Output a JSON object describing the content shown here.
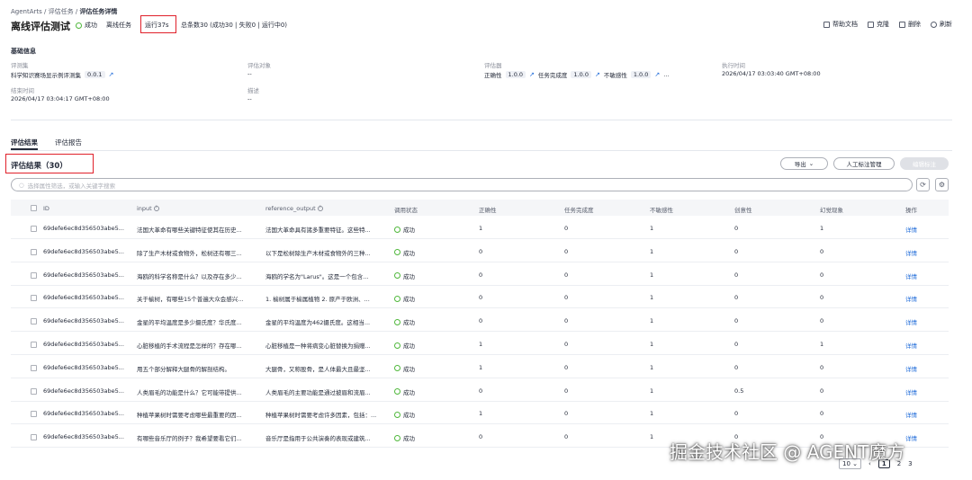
{
  "header": {
    "breadcrumb": [
      "AgentArts",
      "评估任务",
      "评估任务详情"
    ],
    "breadcrumb_sep": "/",
    "title": "离线评估测试",
    "status": "成功",
    "task_type": "离线任务",
    "run_time": "运行37s",
    "summary": "总条数30 (成功30 | 失败0 | 运行中0)",
    "actions": [
      "帮助文档",
      "克隆",
      "删除",
      "刷新"
    ]
  },
  "basic_info": {
    "section_title": "基础信息",
    "eval_set_label": "评测集",
    "eval_set_name": "科学知识赛场显示例评测集",
    "eval_set_version": "0.0.1",
    "eval_target_label": "评估对象",
    "eval_target_value": "--",
    "evaluators_label": "评估器",
    "evaluators": [
      {
        "name": "正确性",
        "version": "1.0.0"
      },
      {
        "name": "任务完成度",
        "version": "1.0.0"
      },
      {
        "name": "不敏感性",
        "version": "1.0.0"
      }
    ],
    "evaluators_more": "...",
    "exec_time_label": "执行时间",
    "exec_time_value": "2026/04/17 03:03:40 GMT+08:00",
    "end_time_label": "结束时间",
    "end_time_value": "2026/04/17 03:04:17 GMT+08:00",
    "desc_label": "描述",
    "desc_value": "--"
  },
  "tabs": [
    "评估结果",
    "评估报告"
  ],
  "results": {
    "title": "评估结果（30）",
    "export_label": "导出",
    "manual_label": "人工标注管理",
    "edit_label": "编辑标注",
    "search_placeholder": "选择属性筛选，或输入关键字搜索",
    "refresh_icon": "refresh-icon",
    "settings_icon": "gear-icon",
    "columns": [
      "ID",
      "input",
      "reference_output",
      "调用状态",
      "正确性",
      "任务完成度",
      "不敏感性",
      "创意性",
      "幻觉现象",
      "操作"
    ],
    "rows": [
      {
        "id": "69defe6ec8d356503abe5...",
        "input": "法国大革命有哪些关键特征使其在历史...",
        "ref": "法国大革命具有諸多重要特征。这些特...",
        "status": "成功",
        "c1": "1",
        "c2": "0",
        "c3": "1",
        "c4": "0",
        "c5": "1",
        "op": "详情"
      },
      {
        "id": "69defe6ec8d356503abe5...",
        "input": "除了生产木材或食物外，松树还有哪三...",
        "ref": "以下是松树除生产木材或食物外的三种...",
        "status": "成功",
        "c1": "0",
        "c2": "0",
        "c3": "1",
        "c4": "0",
        "c5": "0",
        "op": "详情"
      },
      {
        "id": "69defe6ec8d356503abe5...",
        "input": "海鸥的科学名称是什么？以及存在多少...",
        "ref": "海鸥的学名为\"Larus\"。这是一个包含...",
        "status": "成功",
        "c1": "0",
        "c2": "0",
        "c3": "1",
        "c4": "0",
        "c5": "0",
        "op": "详情"
      },
      {
        "id": "69defe6ec8d356503abe5...",
        "input": "关于榆树，有哪些15个普遍大众会感兴...",
        "ref": "1. 榆树属于榆属植物 2. 原产于欧洲、...",
        "status": "成功",
        "c1": "0",
        "c2": "0",
        "c3": "1",
        "c4": "0",
        "c5": "0",
        "op": "详情"
      },
      {
        "id": "69defe6ec8d356503abe5...",
        "input": "金星的平均温度是多少摄氏度？华氏度...",
        "ref": "金星的平均温度为462摄氏度。这相当...",
        "status": "成功",
        "c1": "0",
        "c2": "0",
        "c3": "1",
        "c4": "0",
        "c5": "0",
        "op": "详情"
      },
      {
        "id": "69defe6ec8d356503abe5...",
        "input": "心脏移植的手术流程是怎样的？存在哪...",
        "ref": "心脏移植是一种将病变心脏替换为捐赠...",
        "status": "成功",
        "c1": "1",
        "c2": "0",
        "c3": "1",
        "c4": "0",
        "c5": "1",
        "op": "详情"
      },
      {
        "id": "69defe6ec8d356503abe5...",
        "input": "用五个部分解释大腿骨的解剖结构。",
        "ref": "大腿骨，又称股骨，是人体最大且最坚...",
        "status": "成功",
        "c1": "1",
        "c2": "0",
        "c3": "1",
        "c4": "0",
        "c5": "0",
        "op": "详情"
      },
      {
        "id": "69defe6ec8d356503abe5...",
        "input": "人类眉毛的功能是什么？它可能带提供...",
        "ref": "人类眉毛的主要功能是通过披眉和流眉...",
        "status": "成功",
        "c1": "0",
        "c2": "0",
        "c3": "1",
        "c4": "0.5",
        "c5": "0",
        "op": "详情"
      },
      {
        "id": "69defe6ec8d356503abe5...",
        "input": "种植苹果树时需要考虑哪些最重要的因...",
        "ref": "种植苹果树时需要考虑许多因素，包括：...",
        "status": "成功",
        "c1": "1",
        "c2": "0",
        "c3": "1",
        "c4": "0",
        "c5": "0",
        "op": "详情"
      },
      {
        "id": "69defe6ec8d356503abe5...",
        "input": "有哪些音乐厅的例子？我希望要看它们...",
        "ref": "音乐厅是指用于公共演奏的表现或建筑...",
        "status": "成功",
        "c1": "0",
        "c2": "0",
        "c3": "1",
        "c4": "0",
        "c5": "0",
        "op": "详情"
      }
    ]
  },
  "pager": {
    "size": "10",
    "pages": [
      "1",
      "2",
      "3"
    ]
  },
  "watermark": "掘金技术社区 @ AGENT魔方",
  "colors": {
    "success": "#50b83c",
    "highlight_box": "#e0202a",
    "link": "#1e6bd9"
  }
}
